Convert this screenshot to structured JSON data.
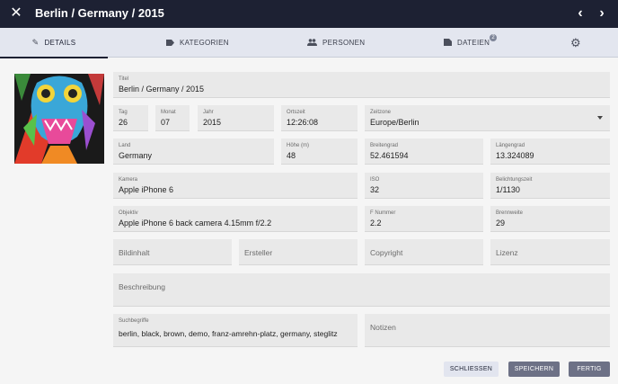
{
  "header": {
    "title": "Berlin / Germany / 2015"
  },
  "tabs": {
    "details": "DETAILS",
    "kategorien": "KATEGORIEN",
    "personen": "PERSONEN",
    "dateien": "DATEIEN",
    "dateien_badge": "2"
  },
  "icons": {
    "close": "close-icon",
    "prev": "chevron-left-icon",
    "next": "chevron-right-icon",
    "details": "pencil-icon",
    "kategorien": "label-icon",
    "personen": "people-icon",
    "dateien": "folder-icon",
    "settings": "gear-icon"
  },
  "fields": {
    "titel": {
      "label": "Titel",
      "value": "Berlin / Germany / 2015"
    },
    "tag": {
      "label": "Tag",
      "value": "26"
    },
    "monat": {
      "label": "Monat",
      "value": "07"
    },
    "jahr": {
      "label": "Jahr",
      "value": "2015"
    },
    "ortszeit": {
      "label": "Ortszeit",
      "value": "12:26:08"
    },
    "zeitzone": {
      "label": "Zeitzone",
      "value": "Europe/Berlin"
    },
    "land": {
      "label": "Land",
      "value": "Germany"
    },
    "hoehe": {
      "label": "Höhe (m)",
      "value": "48"
    },
    "breitengrad": {
      "label": "Breitengrad",
      "value": "52.461594"
    },
    "laengengrad": {
      "label": "Längengrad",
      "value": "13.324089"
    },
    "kamera": {
      "label": "Kamera",
      "value": "Apple iPhone 6"
    },
    "iso": {
      "label": "ISO",
      "value": "32"
    },
    "belichtungszeit": {
      "label": "Belichtungszeit",
      "value": "1/1130"
    },
    "objektiv": {
      "label": "Objektiv",
      "value": "Apple iPhone 6 back camera 4.15mm f/2.2"
    },
    "fnummer": {
      "label": "F Nummer",
      "value": "2.2"
    },
    "brennweite": {
      "label": "Brennweite",
      "value": "29"
    },
    "bildinhalt": {
      "placeholder": "Bildinhalt"
    },
    "ersteller": {
      "placeholder": "Ersteller"
    },
    "copyright": {
      "placeholder": "Copyright"
    },
    "lizenz": {
      "placeholder": "Lizenz"
    },
    "beschreibung": {
      "placeholder": "Beschreibung"
    },
    "suchbegriffe": {
      "label": "Suchbegriffe",
      "value": "berlin, black, brown, demo, franz-amrehn-platz, germany, steglitz"
    },
    "notizen": {
      "placeholder": "Notizen"
    }
  },
  "buttons": {
    "schliessen": "SCHLIESSEN",
    "speichern": "SPEICHERN",
    "fertig": "FERTIG"
  },
  "colors": {
    "topbar": "#1d2133",
    "tabs": "#e3e6ef",
    "field": "#e9e9e9",
    "primary_button": "#6d7186"
  }
}
